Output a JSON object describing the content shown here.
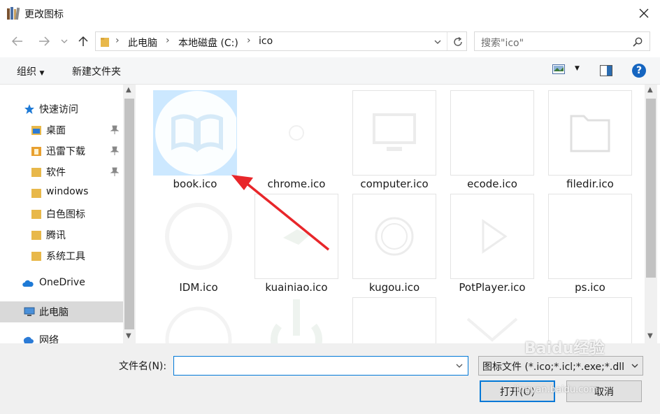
{
  "window": {
    "title": "更改图标"
  },
  "address": {
    "crumbs": [
      "此电脑",
      "本地磁盘 (C:)",
      "ico"
    ]
  },
  "search": {
    "placeholder": "搜索\"ico\""
  },
  "toolbar": {
    "organize_label": "组织",
    "new_folder_label": "新建文件夹"
  },
  "nav": {
    "items": [
      {
        "label": "快速访问"
      },
      {
        "label": "桌面"
      },
      {
        "label": "迅雷下载"
      },
      {
        "label": "软件"
      },
      {
        "label": "windows"
      },
      {
        "label": "白色图标"
      },
      {
        "label": "腾讯"
      },
      {
        "label": "系统工具"
      },
      {
        "label": "OneDrive"
      },
      {
        "label": "此电脑"
      },
      {
        "label": "网络"
      }
    ]
  },
  "files": [
    {
      "name": "book.ico",
      "selected": true
    },
    {
      "name": "chrome.ico"
    },
    {
      "name": "computer.ico"
    },
    {
      "name": "ecode.ico"
    },
    {
      "name": "filedir.ico"
    },
    {
      "name": "IDM.ico"
    },
    {
      "name": "kuainiao.ico"
    },
    {
      "name": "kugou.ico"
    },
    {
      "name": "PotPlayer.ico"
    },
    {
      "name": "ps.ico"
    }
  ],
  "bottom": {
    "filename_label": "文件名(N):",
    "filename_value": "",
    "filter_value": "图标文件 (*.ico;*.icl;*.exe;*.dll",
    "open_label": "打开(O)",
    "cancel_label": "取消"
  },
  "watermark": {
    "text": "Baidu经验",
    "url": "jingyan.baidu.com"
  },
  "colors": {
    "accent": "#0078d7",
    "arrow": "#e8262a",
    "selection": "#cce8ff"
  }
}
